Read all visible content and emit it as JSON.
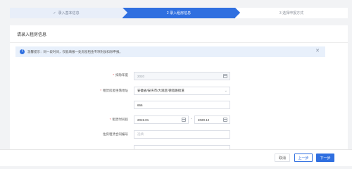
{
  "steps": [
    {
      "label": "录入基本信息",
      "status": "done",
      "icon": "check-icon"
    },
    {
      "label": "2 录入租房信息",
      "status": "active"
    },
    {
      "label": "3 选择申报方式",
      "status": "pending"
    }
  ],
  "card": {
    "title": "请录入租房信息"
  },
  "notice": {
    "text": "温馨提示：同一段时间，仅能填报一处房屋租金专项附加扣除申报。",
    "close_symbol": "✕",
    "info_symbol": "!"
  },
  "form": {
    "year": {
      "label": "扣除年度",
      "value": "2020"
    },
    "city": {
      "label": "租赁房屋坐落地址",
      "value": "安徽省/安庆市/大观区/德宽路街道"
    },
    "address_detail": {
      "value": "666"
    },
    "period": {
      "label": "租赁时间段",
      "start": "2019.01",
      "separator": "-",
      "end": "2020.12"
    },
    "contract": {
      "label": "住房租赁合同编号",
      "placeholder": "选填"
    }
  },
  "footer": {
    "cancel_label": "取消",
    "prev_label": "上一步",
    "next_label": "下一步"
  },
  "colors": {
    "primary": "#2f6fe0",
    "required": "#e34d4d"
  }
}
